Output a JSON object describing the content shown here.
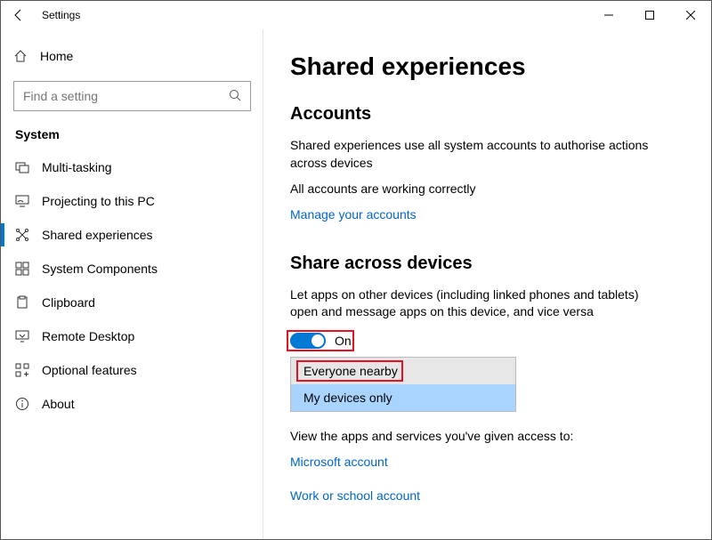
{
  "window": {
    "title": "Settings"
  },
  "sidebar": {
    "home": "Home",
    "searchPlaceholder": "Find a setting",
    "section": "System",
    "items": [
      {
        "label": "Multi-tasking"
      },
      {
        "label": "Projecting to this PC"
      },
      {
        "label": "Shared experiences"
      },
      {
        "label": "System Components"
      },
      {
        "label": "Clipboard"
      },
      {
        "label": "Remote Desktop"
      },
      {
        "label": "Optional features"
      },
      {
        "label": "About"
      }
    ]
  },
  "content": {
    "pageTitle": "Shared experiences",
    "accounts": {
      "heading": "Accounts",
      "desc": "Shared experiences use all system accounts to authorise actions across devices",
      "status": "All accounts are working correctly",
      "manageLink": "Manage your accounts"
    },
    "share": {
      "heading": "Share across devices",
      "desc": "Let apps on other devices (including linked phones and tablets) open and message apps on this device, and vice versa",
      "toggleLabel": "On",
      "options": [
        "Everyone nearby",
        "My devices only"
      ]
    },
    "access": {
      "desc": "View the apps and services you've given access to:",
      "link1": "Microsoft account",
      "link2": "Work or school account"
    }
  }
}
